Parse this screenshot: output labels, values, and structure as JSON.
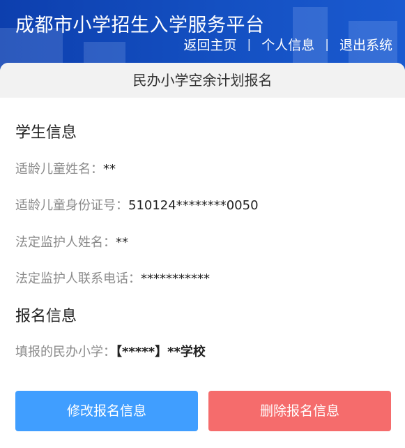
{
  "header": {
    "title": "成都市小学招生入学服务平台",
    "nav": {
      "home": "返回主页",
      "profile": "个人信息",
      "logout": "退出系统",
      "separator": "|"
    }
  },
  "page": {
    "title": "民办小学空余计划报名"
  },
  "student_section": {
    "heading": "学生信息",
    "fields": [
      {
        "label": "适龄儿童姓名：",
        "value": "**"
      },
      {
        "label": "适龄儿童身份证号：",
        "value": "510124********0050"
      },
      {
        "label": "法定监护人姓名：",
        "value": "**"
      },
      {
        "label": "法定监护人联系电话：",
        "value": "***********"
      }
    ]
  },
  "registration_section": {
    "heading": "报名信息",
    "fields": [
      {
        "label": "填报的民办小学：",
        "value": "【*****】**学校"
      }
    ]
  },
  "actions": {
    "edit_label": "修改报名信息",
    "delete_label": "删除报名信息"
  },
  "colors": {
    "header_blue": "#1450c2",
    "edit_button": "#409eff",
    "delete_button": "#f56c6c"
  }
}
